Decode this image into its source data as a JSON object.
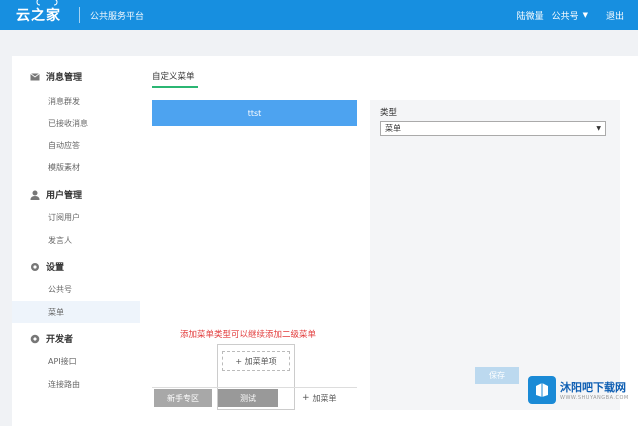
{
  "header": {
    "logo": "云之家",
    "subtitle": "公共服务平台",
    "user": "陆微量",
    "account": "公共号",
    "logout": "退出"
  },
  "sidebar": {
    "groups": [
      {
        "label": "消息管理",
        "icon": "message-icon",
        "items": [
          "消息群发",
          "已接收消息",
          "自动应答",
          "模版素材"
        ]
      },
      {
        "label": "用户管理",
        "icon": "user-icon",
        "items": [
          "订阅用户",
          "发言人"
        ]
      },
      {
        "label": "设置",
        "icon": "gear-icon",
        "items": [
          "公共号",
          "菜单"
        ]
      },
      {
        "label": "开发者",
        "icon": "developer-icon",
        "items": [
          "API接口",
          "连接路由"
        ]
      }
    ],
    "active_item": "菜单"
  },
  "content": {
    "tab_title": "自定义菜单",
    "phone_top_label": "ttst",
    "hint": "添加菜单类型可以继续添加二级菜单",
    "popup_add_item": "+ 加菜单项",
    "bottom_btn_a": "新手专区",
    "bottom_btn_b": "测试",
    "add_menu": "加菜单",
    "panel_label": "类型",
    "panel_select_value": "菜单",
    "save": "保存"
  },
  "watermark": {
    "title": "沐阳吧下载网",
    "url": "WWW.SHUYANGBA.COM"
  }
}
